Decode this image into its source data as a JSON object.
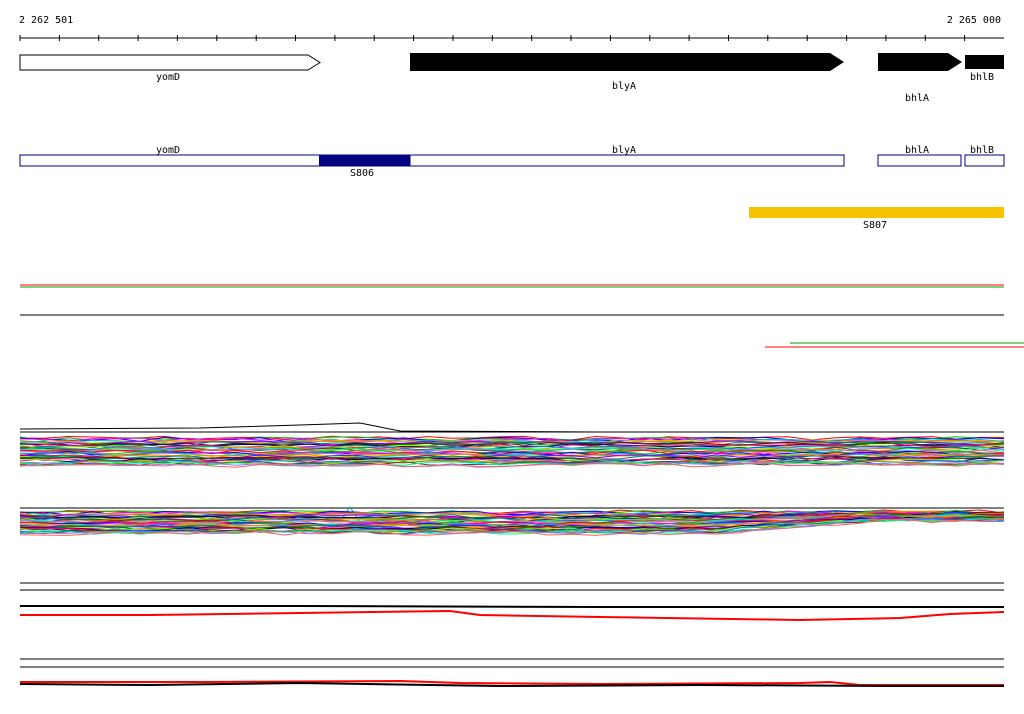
{
  "coords": {
    "start": "2 262 501",
    "end": "2 265 000"
  },
  "genes": [
    {
      "name": "yomD",
      "style": "open"
    },
    {
      "name": "blyA",
      "style": "solid"
    },
    {
      "name": "bhlA",
      "style": "solid"
    },
    {
      "name": "bhlB",
      "style": "solid"
    }
  ],
  "transcripts": [
    {
      "name": "yomD"
    },
    {
      "name": "blyA"
    },
    {
      "name": "bhlA"
    },
    {
      "name": "bhlB"
    }
  ],
  "features": [
    {
      "name": "S806",
      "color": "#000080"
    },
    {
      "name": "S807",
      "color": "#f5c400"
    }
  ],
  "colors": {
    "gene_fill": "#000000",
    "transcript_outline": "#000080",
    "trace_palette": [
      "#ff0000",
      "#00c000",
      "#0000ff",
      "#ff00ff",
      "#00c0c0",
      "#c0c000",
      "#ff8000",
      "#8000ff",
      "#008080",
      "#800000",
      "#008000",
      "#000080",
      "#ff0080",
      "#80ff00",
      "#0080ff",
      "#c08000",
      "#404040",
      "#00ff80",
      "#8080ff",
      "#ff6060"
    ]
  }
}
